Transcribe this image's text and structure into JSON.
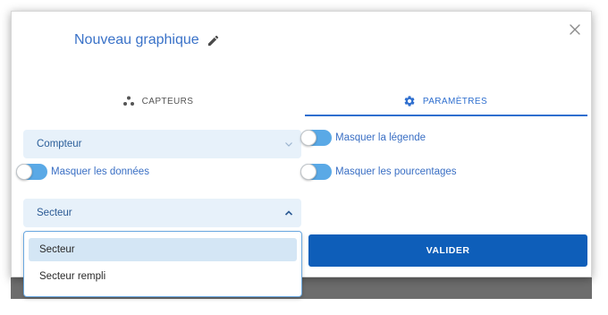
{
  "dialog": {
    "title": "Nouveau graphique",
    "edit_icon": "pencil-icon",
    "close_icon": "close-icon"
  },
  "tabs": [
    {
      "label": "CAPTEURS",
      "icon": "sensors-icon",
      "active": false
    },
    {
      "label": "PARAMÈTRES",
      "icon": "gear-icon",
      "active": true
    }
  ],
  "left": {
    "type_select": {
      "value": "Compteur",
      "open": false
    },
    "hide_data_toggle": {
      "label": "Masquer les données",
      "on": false
    },
    "chart_select": {
      "value": "Secteur",
      "open": true
    },
    "chart_options": [
      {
        "label": "Secteur",
        "selected": true
      },
      {
        "label": "Secteur rempli",
        "selected": false
      }
    ]
  },
  "right": {
    "hide_legend_toggle": {
      "label": "Masquer la légende",
      "on": false
    },
    "hide_percent_toggle": {
      "label": "Masquer les pourcentages",
      "on": false
    },
    "submit_label": "VALIDER"
  },
  "colors": {
    "accent": "#2f6fcf",
    "button": "#0e5eb9",
    "select_bg": "#e7f1fa",
    "toggle": "#5aa9e6",
    "menu_selected": "#d4e6f5"
  }
}
